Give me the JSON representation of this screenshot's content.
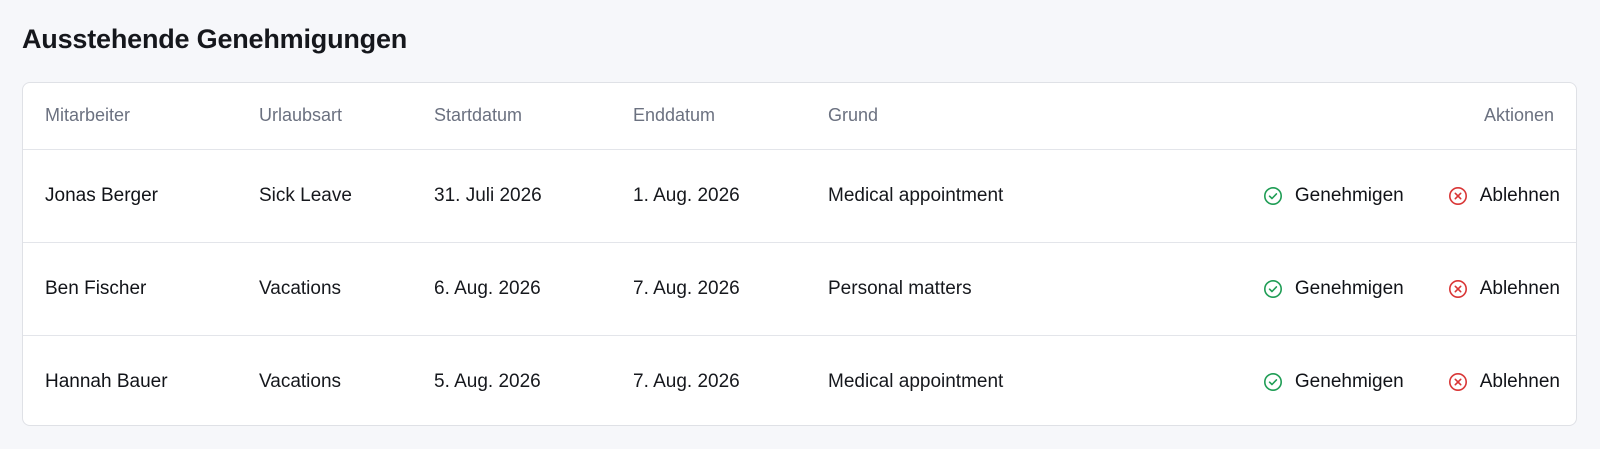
{
  "page": {
    "title": "Ausstehende Genehmigungen"
  },
  "table": {
    "columns": {
      "employee": "Mitarbeiter",
      "leave_type": "Urlaubsart",
      "start": "Startdatum",
      "end": "Enddatum",
      "reason": "Grund",
      "actions": "Aktionen"
    },
    "rows": [
      {
        "employee": "Jonas Berger",
        "leave_type": "Sick Leave",
        "start": "31. Juli 2026",
        "end": "1. Aug. 2026",
        "reason": "Medical appointment"
      },
      {
        "employee": "Ben Fischer",
        "leave_type": "Vacations",
        "start": "6. Aug. 2026",
        "end": "7. Aug. 2026",
        "reason": "Personal matters"
      },
      {
        "employee": "Hannah Bauer",
        "leave_type": "Vacations",
        "start": "5. Aug. 2026",
        "end": "7. Aug. 2026",
        "reason": "Medical appointment"
      }
    ]
  },
  "actions": {
    "approve_label": "Genehmigen",
    "reject_label": "Ablehnen",
    "approve_icon": "check-circle-icon",
    "reject_icon": "x-circle-icon"
  },
  "colors": {
    "approve": "#1f9d55",
    "reject": "#d93636"
  }
}
